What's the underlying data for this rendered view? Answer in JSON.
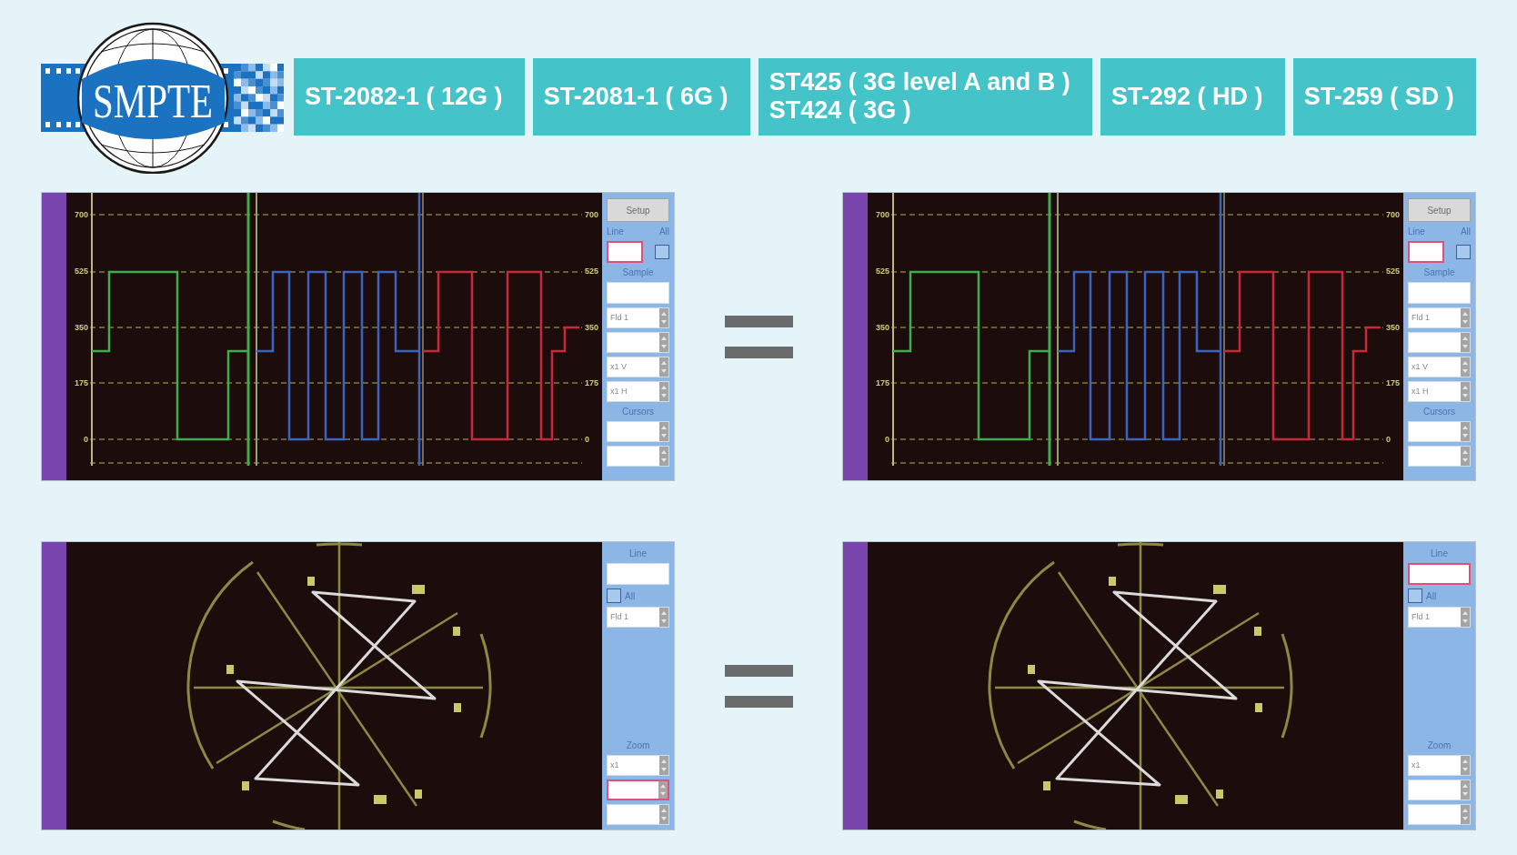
{
  "logo": {
    "text": "SMPTE"
  },
  "standards": [
    {
      "lines": [
        "ST-2082-1 ( 12G )"
      ]
    },
    {
      "lines": [
        "ST-2081-1 ( 6G )"
      ]
    },
    {
      "lines": [
        "ST425 ( 3G level A and B )",
        "ST424 ( 3G )"
      ]
    },
    {
      "lines": [
        "ST-292 ( HD )"
      ]
    },
    {
      "lines": [
        "ST-259 ( SD )"
      ]
    }
  ],
  "rows": [
    {
      "kind": "waveform",
      "panels": [
        {
          "left_scale": [
            "700",
            "525",
            "350",
            "175",
            "0"
          ],
          "right_scale": [
            "700",
            "525",
            "350",
            "175",
            "0"
          ],
          "controls": [
            [
              {
                "kind": "button",
                "label": "Setup"
              },
              {
                "kind": "heading",
                "text": "Line",
                "aside": "All"
              },
              {
                "kind": "field_check",
                "focused": true,
                "checked": false
              },
              {
                "kind": "heading",
                "text": "Sample"
              },
              {
                "kind": "field",
                "focused": false
              },
              {
                "kind": "select",
                "value": "Fld 1",
                "focused": false
              },
              {
                "kind": "select",
                "focused": false
              },
              {
                "kind": "select",
                "value": "x1 V",
                "focused": false
              },
              {
                "kind": "select",
                "value": "x1 H",
                "focused": false
              },
              {
                "kind": "heading",
                "text": "Cursors"
              },
              {
                "kind": "select",
                "focused": false
              },
              {
                "kind": "select",
                "focused": false
              }
            ]
          ]
        },
        {
          "left_scale": [
            "700",
            "525",
            "350",
            "175",
            "0"
          ],
          "right_scale": [
            "700",
            "525",
            "350",
            "175",
            "0"
          ],
          "controls": [
            [
              {
                "kind": "button",
                "label": "Setup"
              },
              {
                "kind": "heading",
                "text": "Line",
                "aside": "All"
              },
              {
                "kind": "field_check",
                "focused": true,
                "checked": false
              },
              {
                "kind": "heading",
                "text": "Sample"
              },
              {
                "kind": "field",
                "focused": false
              },
              {
                "kind": "select",
                "value": "Fld 1",
                "focused": false
              },
              {
                "kind": "select",
                "focused": false
              },
              {
                "kind": "select",
                "value": "x1 V",
                "focused": false
              },
              {
                "kind": "select",
                "value": "x1 H",
                "focused": false
              },
              {
                "kind": "heading",
                "text": "Cursors"
              },
              {
                "kind": "select",
                "focused": false
              },
              {
                "kind": "select",
                "focused": false
              }
            ]
          ]
        }
      ]
    },
    {
      "kind": "vectorscope",
      "panels": [
        {
          "controls": [
            [
              {
                "kind": "heading",
                "text": "Line"
              },
              {
                "kind": "field",
                "focused": false
              },
              {
                "kind": "check",
                "label": "All",
                "checked": false
              },
              {
                "kind": "select",
                "value": "Fld 1",
                "focused": false
              }
            ],
            [
              {
                "kind": "heading",
                "text": "Zoom"
              },
              {
                "kind": "select",
                "value": "x1",
                "focused": false
              },
              {
                "kind": "select",
                "focused": true
              },
              {
                "kind": "select",
                "focused": false
              }
            ]
          ]
        },
        {
          "controls": [
            [
              {
                "kind": "heading",
                "text": "Line"
              },
              {
                "kind": "field",
                "focused": true
              },
              {
                "kind": "check",
                "label": "All",
                "checked": false
              },
              {
                "kind": "select",
                "value": "Fld 1",
                "focused": false
              }
            ],
            [
              {
                "kind": "heading",
                "text": "Zoom"
              },
              {
                "kind": "select",
                "value": "x1",
                "focused": false
              },
              {
                "kind": "select",
                "focused": false
              },
              {
                "kind": "select",
                "focused": false
              }
            ]
          ]
        }
      ]
    }
  ]
}
